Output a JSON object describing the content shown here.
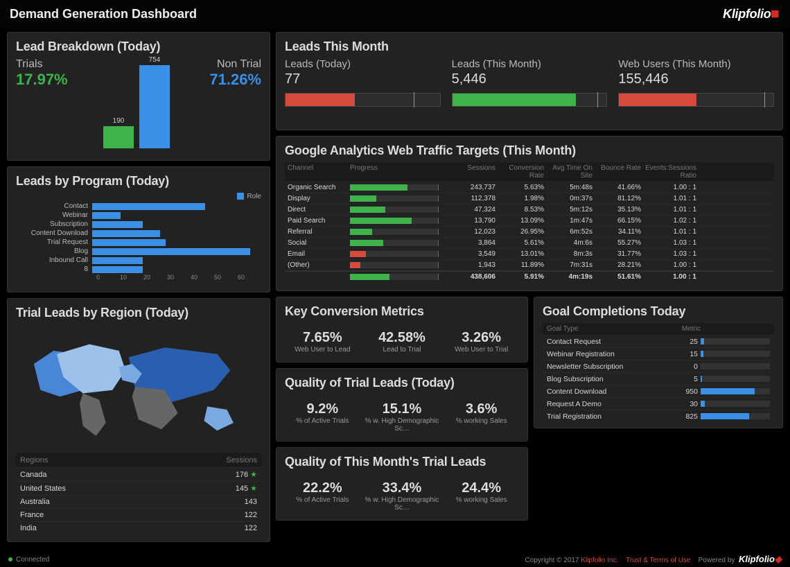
{
  "header": {
    "title": "Demand Generation Dashboard",
    "brand": "Klipfolio"
  },
  "lead_breakdown": {
    "title": "Lead Breakdown (Today)",
    "trials_label": "Trials",
    "nontrial_label": "Non Trial",
    "trials_pct": "17.97%",
    "nontrial_pct": "71.26%",
    "bar_trial": "190",
    "bar_nontrial": "754"
  },
  "leads_by_program": {
    "title": "Leads by Program (Today)",
    "legend": "Role",
    "axis": [
      "0",
      "10",
      "20",
      "30",
      "40",
      "50",
      "60"
    ],
    "rows": [
      {
        "name": "Contact",
        "v": 40
      },
      {
        "name": "Webinar",
        "v": 10
      },
      {
        "name": "Subscription",
        "v": 18
      },
      {
        "name": "Content Download",
        "v": 24
      },
      {
        "name": "Trial Request",
        "v": 26
      },
      {
        "name": "Blog",
        "v": 56
      },
      {
        "name": "Inbound Call",
        "v": 18
      },
      {
        "name": "8",
        "v": 18
      }
    ]
  },
  "trial_region": {
    "title": "Trial Leads by Region (Today)",
    "head_region": "Regions",
    "head_sessions": "Sessions",
    "rows": [
      {
        "name": "Canada",
        "v": "176",
        "star": true
      },
      {
        "name": "United States",
        "v": "145",
        "star": true
      },
      {
        "name": "Australia",
        "v": "143",
        "star": false
      },
      {
        "name": "France",
        "v": "122",
        "star": false
      },
      {
        "name": "India",
        "v": "122",
        "star": false
      }
    ]
  },
  "leads_month": {
    "title": "Leads This Month",
    "items": [
      {
        "label": "Leads (Today)",
        "value": "77",
        "fill": 0.45,
        "color": "red",
        "tick": 0.83
      },
      {
        "label": "Leads (This Month)",
        "value": "5,446",
        "fill": 0.8,
        "color": "green",
        "tick": 0.94
      },
      {
        "label": "Web Users (This Month)",
        "value": "155,446",
        "fill": 0.5,
        "color": "red",
        "tick": 0.94
      }
    ]
  },
  "ga": {
    "title": "Google Analytics Web Traffic Targets (This Month)",
    "head": [
      "Channel",
      "Progress",
      "Sessions",
      "Conversion Rate",
      "Avg Time On Site",
      "Bounce Rate",
      "Events:Sessions Ratio"
    ],
    "rows": [
      {
        "c": "Organic Search",
        "p": 0.65,
        "col": "g",
        "s": "243,737",
        "cr": "5.63%",
        "t": "5m:48s",
        "b": "41.66%",
        "r": "1.00 : 1"
      },
      {
        "c": "Display",
        "p": 0.3,
        "col": "g",
        "s": "112,378",
        "cr": "1.98%",
        "t": "0m:37s",
        "b": "81.12%",
        "r": "1.01 : 1"
      },
      {
        "c": "Direct",
        "p": 0.4,
        "col": "g",
        "s": "47,324",
        "cr": "8.53%",
        "t": "5m:12s",
        "b": "35.13%",
        "r": "1.01 : 1"
      },
      {
        "c": "Paid Search",
        "p": 0.7,
        "col": "g",
        "s": "13,790",
        "cr": "13.09%",
        "t": "1m:47s",
        "b": "66.15%",
        "r": "1.02 : 1"
      },
      {
        "c": "Referral",
        "p": 0.25,
        "col": "g",
        "s": "12,023",
        "cr": "26.95%",
        "t": "6m:52s",
        "b": "34.11%",
        "r": "1.01 : 1"
      },
      {
        "c": "Social",
        "p": 0.38,
        "col": "g",
        "s": "3,864",
        "cr": "5.61%",
        "t": "4m:6s",
        "b": "55.27%",
        "r": "1.03 : 1"
      },
      {
        "c": "Email",
        "p": 0.18,
        "col": "r",
        "s": "3,549",
        "cr": "13.01%",
        "t": "8m:3s",
        "b": "31.77%",
        "r": "1.03 : 1"
      },
      {
        "c": "(Other)",
        "p": 0.12,
        "col": "r",
        "s": "1,943",
        "cr": "11.89%",
        "t": "7m:31s",
        "b": "28.21%",
        "r": "1.00 : 1"
      }
    ],
    "total": {
      "p": 0.45,
      "col": "g",
      "s": "438,606",
      "cr": "5.91%",
      "t": "4m:19s",
      "b": "51.61%",
      "r": "1.00 : 1"
    }
  },
  "km": {
    "title": "Key Conversion Metrics",
    "items": [
      {
        "v": "7.65%",
        "l": "Web User to Lead"
      },
      {
        "v": "42.58%",
        "l": "Lead to Trial"
      },
      {
        "v": "3.26%",
        "l": "Web User to Trial"
      }
    ]
  },
  "qtoday": {
    "title": "Quality of Trial Leads (Today)",
    "items": [
      {
        "v": "9.2%",
        "l": "% of Active Trials"
      },
      {
        "v": "15.1%",
        "l": "% w. High Demographic Sc…"
      },
      {
        "v": "3.6%",
        "l": "% working Sales"
      }
    ]
  },
  "qmonth": {
    "title": "Quality of This Month's Trial Leads",
    "items": [
      {
        "v": "22.2%",
        "l": "% of Active Trials"
      },
      {
        "v": "33.4%",
        "l": "% w. High Demographic Sc…"
      },
      {
        "v": "24.4%",
        "l": "% working Sales"
      }
    ]
  },
  "goals": {
    "title": "Goal Completions Today",
    "head": [
      "Goal Type",
      "Metric",
      ""
    ],
    "rows": [
      {
        "n": "Contact Request",
        "v": "25",
        "p": 0.05
      },
      {
        "n": "Webinar Registration",
        "v": "15",
        "p": 0.04
      },
      {
        "n": "Newsletter Subscription",
        "v": "0",
        "p": 0.0
      },
      {
        "n": "Blog Subscription",
        "v": "5",
        "p": 0.02
      },
      {
        "n": "Content Download",
        "v": "950",
        "p": 0.78
      },
      {
        "n": "Request A Demo",
        "v": "30",
        "p": 0.06
      },
      {
        "n": "Trial Registration",
        "v": "825",
        "p": 0.7
      }
    ]
  },
  "footer": {
    "connected": "Connected",
    "copyright": "Copyright © 2017",
    "company": "Klipfolio Inc.",
    "terms": "Trust & Terms of Use",
    "powered": "Powered by",
    "brand": "Klipfolio"
  },
  "chart_data": [
    {
      "type": "bar",
      "title": "Lead Breakdown (Today)",
      "categories": [
        "Trial",
        "Non Trial"
      ],
      "values": [
        190,
        754
      ]
    },
    {
      "type": "bar",
      "title": "Leads by Program (Today)",
      "orientation": "horizontal",
      "categories": [
        "Contact",
        "Webinar",
        "Subscription",
        "Content Download",
        "Trial Request",
        "Blog",
        "Inbound Call",
        "8"
      ],
      "values": [
        40,
        10,
        18,
        24,
        26,
        56,
        18,
        18
      ],
      "xlim": [
        0,
        60
      ],
      "series_name": "Role"
    },
    {
      "type": "bar",
      "title": "Goal Completions Today",
      "orientation": "horizontal",
      "categories": [
        "Contact Request",
        "Webinar Registration",
        "Newsletter Subscription",
        "Blog Subscription",
        "Content Download",
        "Request A Demo",
        "Trial Registration"
      ],
      "values": [
        25,
        15,
        0,
        5,
        950,
        30,
        825
      ]
    },
    {
      "type": "table",
      "title": "Google Analytics Web Traffic Targets (This Month)",
      "columns": [
        "Channel",
        "Sessions",
        "Conversion Rate",
        "Avg Time On Site",
        "Bounce Rate",
        "Events:Sessions Ratio"
      ],
      "rows": [
        [
          "Organic Search",
          243737,
          0.0563,
          "5m:48s",
          0.4166,
          "1.00 : 1"
        ],
        [
          "Display",
          112378,
          0.0198,
          "0m:37s",
          0.8112,
          "1.01 : 1"
        ],
        [
          "Direct",
          47324,
          0.0853,
          "5m:12s",
          0.3513,
          "1.01 : 1"
        ],
        [
          "Paid Search",
          13790,
          0.1309,
          "1m:47s",
          0.6615,
          "1.02 : 1"
        ],
        [
          "Referral",
          12023,
          0.2695,
          "6m:52s",
          0.3411,
          "1.01 : 1"
        ],
        [
          "Social",
          3864,
          0.0561,
          "4m:6s",
          0.5527,
          "1.03 : 1"
        ],
        [
          "Email",
          3549,
          0.1301,
          "8m:3s",
          0.3177,
          "1.03 : 1"
        ],
        [
          "(Other)",
          1943,
          0.1189,
          "7m:31s",
          0.2821,
          "1.00 : 1"
        ]
      ],
      "total": [
        "",
        438606,
        0.0591,
        "4m:19s",
        0.5161,
        "1.00 : 1"
      ]
    }
  ]
}
